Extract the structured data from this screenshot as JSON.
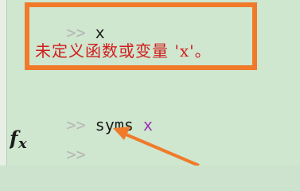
{
  "console": {
    "prompt": ">>",
    "line1_cmd": "x",
    "error_msg": "未定义函数或变量 'x'。",
    "line2_cmd": "syms",
    "line2_var": "x",
    "line3_prompt": ">>"
  },
  "colors": {
    "background": "#cfe6cf",
    "highlight": "#f07a2a",
    "error_text": "#d11d1d",
    "variable": "#9a2fb0",
    "prompt": "#b6b6b6"
  },
  "icons": {
    "fx": "fx-icon"
  }
}
